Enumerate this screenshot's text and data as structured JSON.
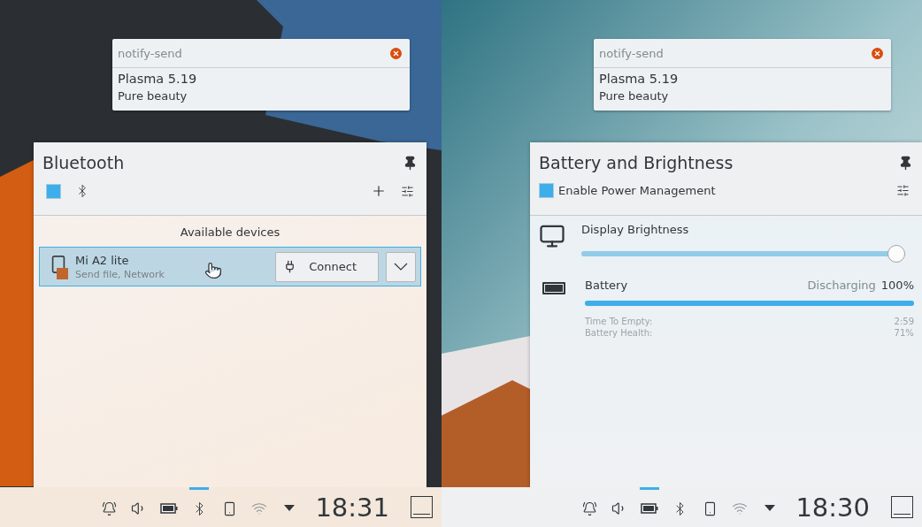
{
  "screens": [
    {
      "notification": {
        "app": "notify-send",
        "title": "Plasma 5.19",
        "body": "Pure beauty"
      },
      "popup": {
        "kind": "bluetooth",
        "title": "Bluetooth",
        "toggle": {
          "checked": true
        },
        "section": "Available devices",
        "devices": [
          {
            "name": "Mi A2 lite",
            "services": "Send file, Network",
            "selected": true,
            "action": "Connect"
          }
        ]
      },
      "taskbar": {
        "tray": [
          {
            "kind": "bell",
            "selected": false
          },
          {
            "kind": "volume",
            "selected": false
          },
          {
            "kind": "battery",
            "selected": false
          },
          {
            "kind": "bluetooth",
            "selected": true
          },
          {
            "kind": "phone",
            "selected": false
          },
          {
            "kind": "wifi",
            "selected": false
          },
          {
            "kind": "expand",
            "selected": false
          }
        ],
        "clock": "18:31"
      }
    },
    {
      "notification": {
        "app": "notify-send",
        "title": "Plasma 5.19",
        "body": "Pure beauty"
      },
      "popup": {
        "kind": "power",
        "title": "Battery and Brightness",
        "power_management": {
          "label": "Enable Power Management",
          "checked": true
        },
        "brightness": {
          "label": "Display Brightness",
          "level": 1.0
        },
        "battery": {
          "label": "Battery",
          "status": "Discharging",
          "percent": "100%",
          "level": 1.0,
          "details": [
            {
              "label": "Time To Empty:",
              "value": "2:59"
            },
            {
              "label": "Battery Health:",
              "value": "71%"
            }
          ]
        }
      },
      "taskbar": {
        "tray": [
          {
            "kind": "bell",
            "selected": false
          },
          {
            "kind": "volume",
            "selected": false
          },
          {
            "kind": "battery",
            "selected": true
          },
          {
            "kind": "bluetooth",
            "selected": false
          },
          {
            "kind": "phone",
            "selected": false
          },
          {
            "kind": "wifi",
            "selected": false
          },
          {
            "kind": "expand",
            "selected": false
          }
        ],
        "clock": "18:30"
      }
    }
  ]
}
